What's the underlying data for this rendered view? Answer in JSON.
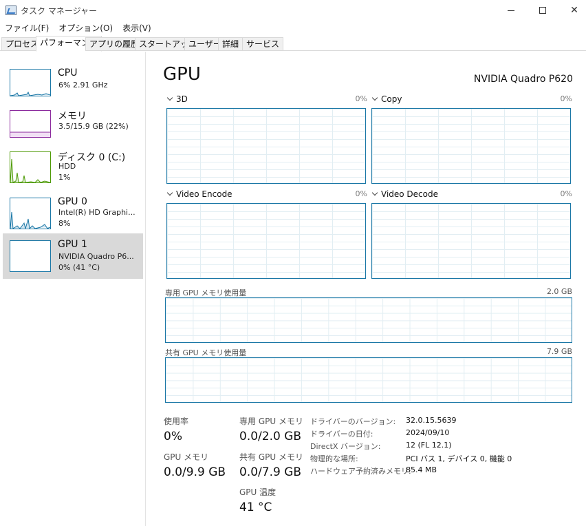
{
  "window": {
    "title": "タスク マネージャー",
    "icon": "task-manager-icon"
  },
  "menu": [
    "ファイル(F)",
    "オプション(O)",
    "表示(V)"
  ],
  "tabs": [
    {
      "label": "プロセス",
      "active": false
    },
    {
      "label": "パフォーマンス",
      "active": true
    },
    {
      "label": "アプリの履歴",
      "active": false
    },
    {
      "label": "スタートアップ",
      "active": false
    },
    {
      "label": "ユーザー",
      "active": false
    },
    {
      "label": "詳細",
      "active": false
    },
    {
      "label": "サービス",
      "active": false
    }
  ],
  "sidebar": {
    "items": [
      {
        "name": "CPU",
        "line1": "6%  2.91 GHz",
        "line2": "",
        "color": "#1a77a6",
        "selected": false
      },
      {
        "name": "メモリ",
        "line1": "3.5/15.9 GB (22%)",
        "line2": "",
        "color": "#8b2a9d",
        "selected": false
      },
      {
        "name": "ディスク 0 (C:)",
        "line1": "HDD",
        "line2": "1%",
        "color": "#4e9a06",
        "selected": false
      },
      {
        "name": "GPU 0",
        "line1": "Intel(R) HD Graphi...",
        "line2": "8%",
        "color": "#1a77a6",
        "selected": false
      },
      {
        "name": "GPU 1",
        "line1": "NVIDIA Quadro P6...",
        "line2": "0% (41 °C)",
        "color": "#1a77a6",
        "selected": true
      }
    ]
  },
  "main": {
    "title": "GPU",
    "device": "NVIDIA Quadro P620",
    "engines": [
      {
        "label": "3D",
        "percent": "0%"
      },
      {
        "label": "Copy",
        "percent": "0%"
      },
      {
        "label": "Video Encode",
        "percent": "0%"
      },
      {
        "label": "Video Decode",
        "percent": "0%"
      }
    ],
    "dedicated_memory": {
      "label": "専用 GPU メモリ使用量",
      "max": "2.0 GB"
    },
    "shared_memory": {
      "label": "共有 GPU メモリ使用量",
      "max": "7.9 GB"
    }
  },
  "stats": {
    "utilization": {
      "label": "使用率",
      "value": "0%"
    },
    "gpu_memory": {
      "label": "GPU メモリ",
      "value": "0.0/9.9 GB"
    },
    "dedicated": {
      "label": "専用 GPU メモリ",
      "value": "0.0/2.0 GB"
    },
    "shared": {
      "label": "共有 GPU メモリ",
      "value": "0.0/7.9 GB"
    },
    "temperature": {
      "label": "GPU 温度",
      "value": "41 °C"
    }
  },
  "info": [
    {
      "key": "ドライバーのバージョン:",
      "value": "32.0.15.5639"
    },
    {
      "key": "ドライバーの日付:",
      "value": "2024/09/10"
    },
    {
      "key": "DirectX バージョン:",
      "value": "12 (FL 12.1)"
    },
    {
      "key": "物理的な場所:",
      "value": "PCI バス 1, デバイス 0, 機能 0"
    },
    {
      "key": "ハードウェア予約済みメモリ:",
      "value": "85.4 MB"
    }
  ]
}
